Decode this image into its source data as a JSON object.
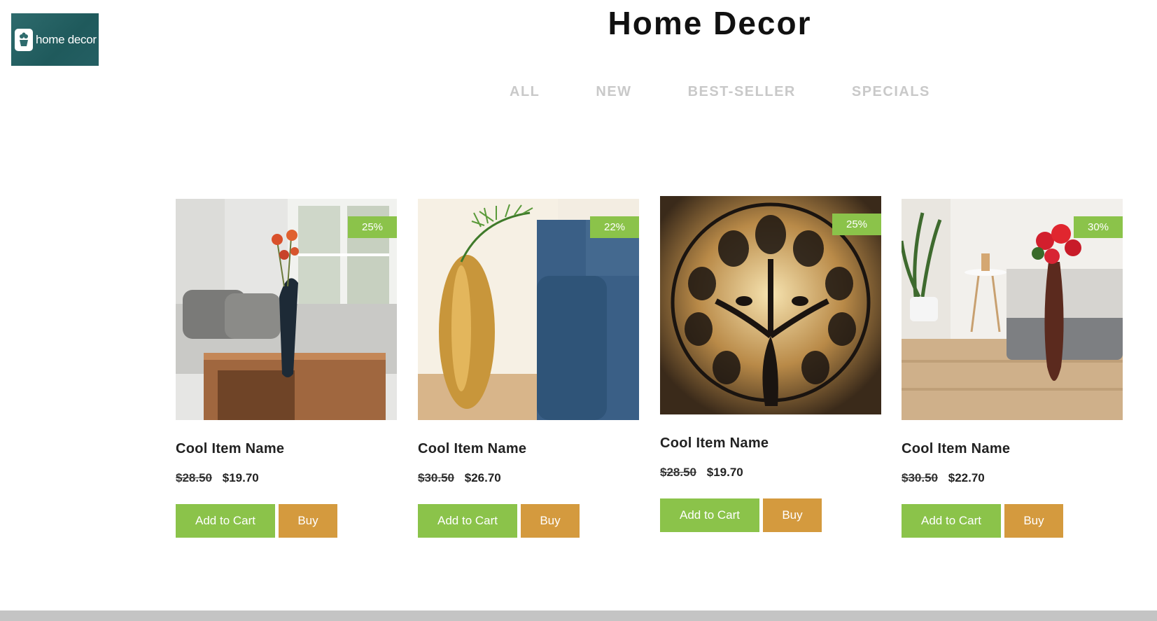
{
  "brand": {
    "logo_text": "home decor",
    "logo_icon": "plant-pot-icon",
    "logo_bg": "#2e6b6d"
  },
  "header": {
    "title": "Home Decor"
  },
  "filters": [
    {
      "label": "ALL"
    },
    {
      "label": "NEW"
    },
    {
      "label": "BEST-SELLER"
    },
    {
      "label": "SPECIALS"
    }
  ],
  "colors": {
    "accent_green": "#8bc34a",
    "accent_orange": "#d49a3e",
    "filter_inactive": "#c9c9c9"
  },
  "products": [
    {
      "image": "hand-vase-with-roses-living-room",
      "discount": "25%",
      "name": "Cool Item Name",
      "old_price": "$28.50",
      "price": "$19.70",
      "cart_label": "Add to Cart",
      "buy_label": "Buy"
    },
    {
      "image": "gold-hammered-vase-with-palm-leaf",
      "discount": "22%",
      "name": "Cool Item Name",
      "old_price": "$30.50",
      "price": "$26.70",
      "cart_label": "Add to Cart",
      "buy_label": "Buy"
    },
    {
      "image": "tree-of-life-metal-wall-art",
      "discount": "25%",
      "name": "Cool Item Name",
      "old_price": "$28.50",
      "price": "$19.70",
      "cart_label": "Add to Cart",
      "buy_label": "Buy"
    },
    {
      "image": "brown-tall-vase-with-red-roses",
      "discount": "30%",
      "name": "Cool Item Name",
      "old_price": "$30.50",
      "price": "$22.70",
      "cart_label": "Add to Cart",
      "buy_label": "Buy"
    }
  ]
}
